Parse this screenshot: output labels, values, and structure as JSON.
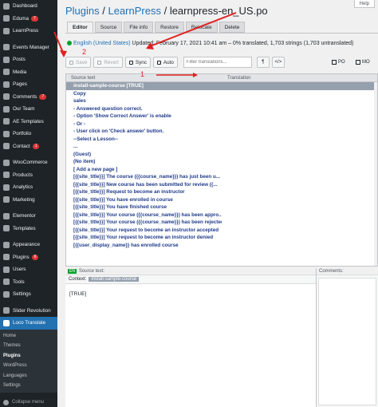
{
  "sidebar": {
    "items": [
      {
        "label": "Dashboard",
        "icon": "dashboard-icon"
      },
      {
        "label": "Eduma",
        "icon": "eduma-icon",
        "badge": "7"
      },
      {
        "label": "LearnPress",
        "icon": "learnpress-icon"
      },
      {
        "label": "Events Manager",
        "icon": "calendar-icon"
      },
      {
        "label": "Posts",
        "icon": "pin-icon"
      },
      {
        "label": "Media",
        "icon": "media-icon"
      },
      {
        "label": "Pages",
        "icon": "page-icon"
      },
      {
        "label": "Comments",
        "icon": "comment-icon",
        "badge": "7"
      },
      {
        "label": "Our Team",
        "icon": "team-icon"
      },
      {
        "label": "AE Templates",
        "icon": "template-icon"
      },
      {
        "label": "Portfolio",
        "icon": "portfolio-icon"
      },
      {
        "label": "Contact",
        "icon": "mail-icon",
        "badge": "1"
      },
      {
        "label": "WooCommerce",
        "icon": "woo-icon"
      },
      {
        "label": "Products",
        "icon": "product-icon"
      },
      {
        "label": "Analytics",
        "icon": "analytics-icon"
      },
      {
        "label": "Marketing",
        "icon": "megaphone-icon"
      },
      {
        "label": "Elementor",
        "icon": "elementor-icon"
      },
      {
        "label": "Templates",
        "icon": "folder-icon"
      },
      {
        "label": "Appearance",
        "icon": "brush-icon"
      },
      {
        "label": "Plugins",
        "icon": "plugin-icon",
        "badge": "6"
      },
      {
        "label": "Users",
        "icon": "user-icon"
      },
      {
        "label": "Tools",
        "icon": "wrench-icon"
      },
      {
        "label": "Settings",
        "icon": "settings-icon"
      },
      {
        "label": "Slider Revolution",
        "icon": "slider-icon"
      },
      {
        "label": "Loco Translate",
        "icon": "translate-icon"
      }
    ],
    "submenu": [
      "Home",
      "Themes",
      "Plugins",
      "WordPress",
      "Languages",
      "Settings"
    ],
    "collapse_label": "Collapse menu"
  },
  "help_label": "Help",
  "breadcrumb": {
    "plugins": "Plugins",
    "sep": " / ",
    "learnpress": "LearnPress",
    "file": "learnpress-en_US.po"
  },
  "tabs": [
    "Editor",
    "Source",
    "File info",
    "Restore",
    "Relocate",
    "Delete"
  ],
  "locale": {
    "name": "English (United States)",
    "status": "Updated: February 17, 2021 10:41 am – 0% translated, 1,703 strings (1,703 untranslated)"
  },
  "toolbar": {
    "save": "Save",
    "revert": "Revert",
    "sync": "Sync",
    "auto": "Auto",
    "filter_placeholder": "Filter translations...",
    "pilcrow": "¶",
    "code": "</>",
    "po": "PO",
    "mo": "MO"
  },
  "grid": {
    "headers": [
      "Source text",
      "Translation"
    ],
    "rows": [
      "install-sample-course [TRUE]",
      "Copy",
      "sales",
      "- Answered question correct.",
      "- Option 'Show Correct Answer' is enable",
      "- Or -",
      "- User click on 'Check answer' button.",
      "--Select a Lesson--",
      "...",
      "(Guest)",
      "(No item)",
      "[ Add a new page ]",
      "[{{site_title}}] The course ({{course_name}}) has just been u...",
      "[{{site_title}}] New course has been submitted for review ({...",
      "[{{site_title}}] Request to become an instructor",
      "[{{site_title}}] You have enrolled in course",
      "[{{site_title}}] You have finished course",
      "[{{site_title}}] Your course ({{course_name}}) has been appro...",
      "[{{site_title}}] Your course ({{course_name}}) has been rejected",
      "[{{site_title}}] Your request to become an instructor accepted",
      "[{{site_title}}] Your request to become an instructor denied",
      "[{{user_display_name}} has enrolled course"
    ]
  },
  "editor": {
    "lang": "EN",
    "source_label": "Source text:",
    "context_label": "Context:",
    "context_value": "install-sample-course",
    "source_value": "[TRUE]"
  },
  "comments_label": "Comments:",
  "annotations": {
    "one": "1",
    "two": "2"
  },
  "colors": {
    "sidebar": "#1d2327",
    "accent": "#2271b1",
    "annotation": "#e02020",
    "selected_row": "#95a0ae"
  }
}
